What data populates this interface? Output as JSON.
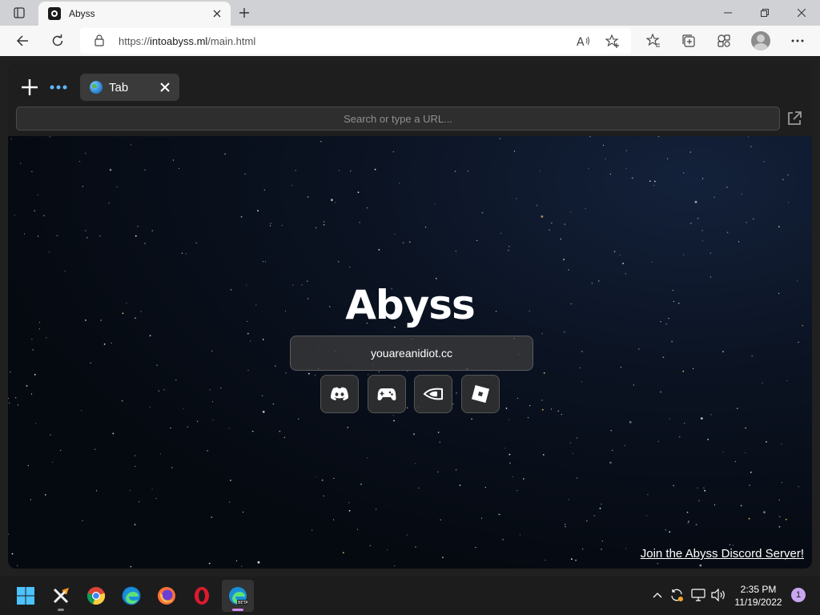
{
  "browser": {
    "tab_title": "Abyss",
    "url_prefix": "https://",
    "url_host": "intoabyss.ml",
    "url_path": "/main.html"
  },
  "abyss": {
    "tab_label": "Tab",
    "search_placeholder": "Search or type a URL...",
    "title": "Abyss",
    "main_input_value": "youareanidiot.cc",
    "discord_link": "Join the Abyss Discord Server!",
    "quick_links": [
      "discord-icon",
      "gamepad-icon",
      "nvidia-icon",
      "roblox-icon"
    ]
  },
  "taskbar": {
    "apps": [
      "start-icon",
      "xampp-icon",
      "chrome-icon",
      "edge-icon",
      "firefox-icon",
      "opera-icon",
      "edge-beta-icon"
    ],
    "active_app": "edge-beta-icon",
    "time": "2:35 PM",
    "date": "11/19/2022",
    "notification_count": "1"
  },
  "colors": {
    "page_bg": "#202020",
    "abyss_header": "#1e1e1e",
    "accent_indicator": "#d48cf0"
  }
}
